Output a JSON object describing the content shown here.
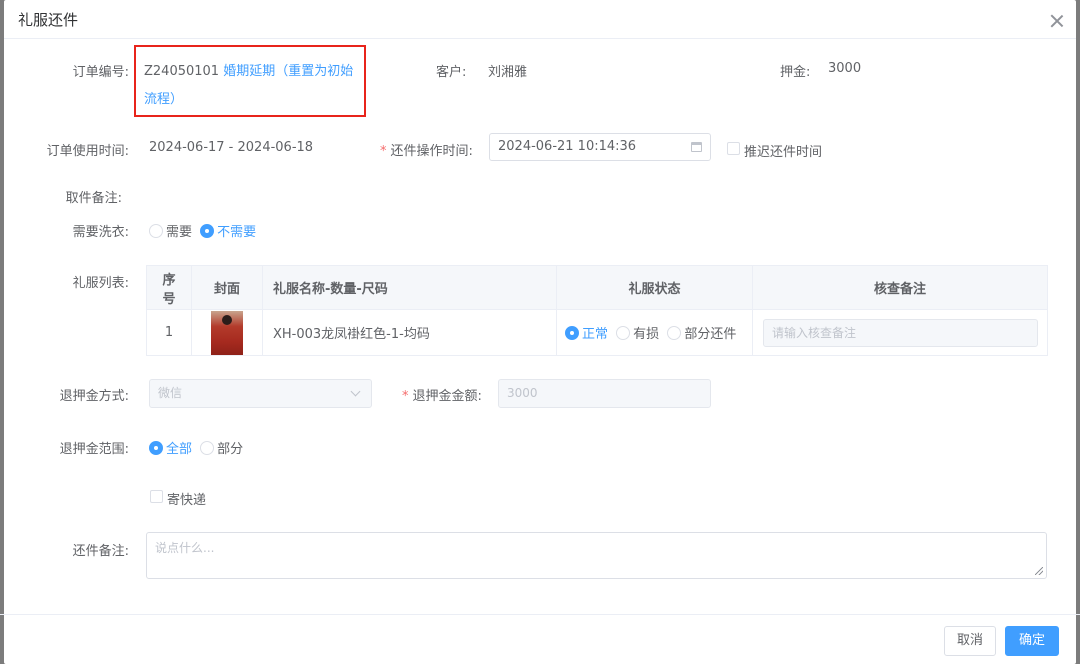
{
  "dialog": {
    "title": "礼服还件"
  },
  "order": {
    "label": "订单编号:",
    "number": "Z24050101",
    "link": "婚期延期（重置为初始流程）",
    "customer_label": "客户:",
    "customer": "刘湘雅",
    "deposit_label": "押金:",
    "deposit": "3000"
  },
  "usage": {
    "label": "订单使用时间:",
    "range": "2024-06-17 - 2024-06-18",
    "return_time_label": "还件操作时间:",
    "return_time": "2024-06-21 10:14:36",
    "postpone_label": "推迟还件时间"
  },
  "pickup_note": {
    "label": "取件备注:"
  },
  "washing": {
    "label": "需要洗衣:",
    "options": [
      "需要",
      "不需要"
    ],
    "selected": "不需要"
  },
  "dress_list": {
    "label": "礼服列表:",
    "columns": [
      "序号",
      "封面",
      "礼服名称-数量-尺码",
      "礼服状态",
      "核查备注"
    ],
    "rows": [
      {
        "index": "1",
        "name": "XH-003龙凤褂红色-1-均码",
        "status_options": [
          "正常",
          "有损",
          "部分还件"
        ],
        "status_selected": "正常",
        "check_note_placeholder": "请输入核查备注"
      }
    ]
  },
  "refund": {
    "method_label": "退押金方式:",
    "method": "微信",
    "amount_label": "退押金金额:",
    "amount": "3000",
    "scope_label": "退押金范围:",
    "scope_options": [
      "全部",
      "部分"
    ],
    "scope_selected": "全部",
    "express_label": "寄快递"
  },
  "return_note": {
    "label": "还件备注:",
    "placeholder": "说点什么..."
  },
  "footer": {
    "cancel": "取消",
    "confirm": "确定"
  },
  "colors": {
    "primary": "#409eff",
    "highlight_box": "#e8241b",
    "required": "#f56c6c"
  }
}
